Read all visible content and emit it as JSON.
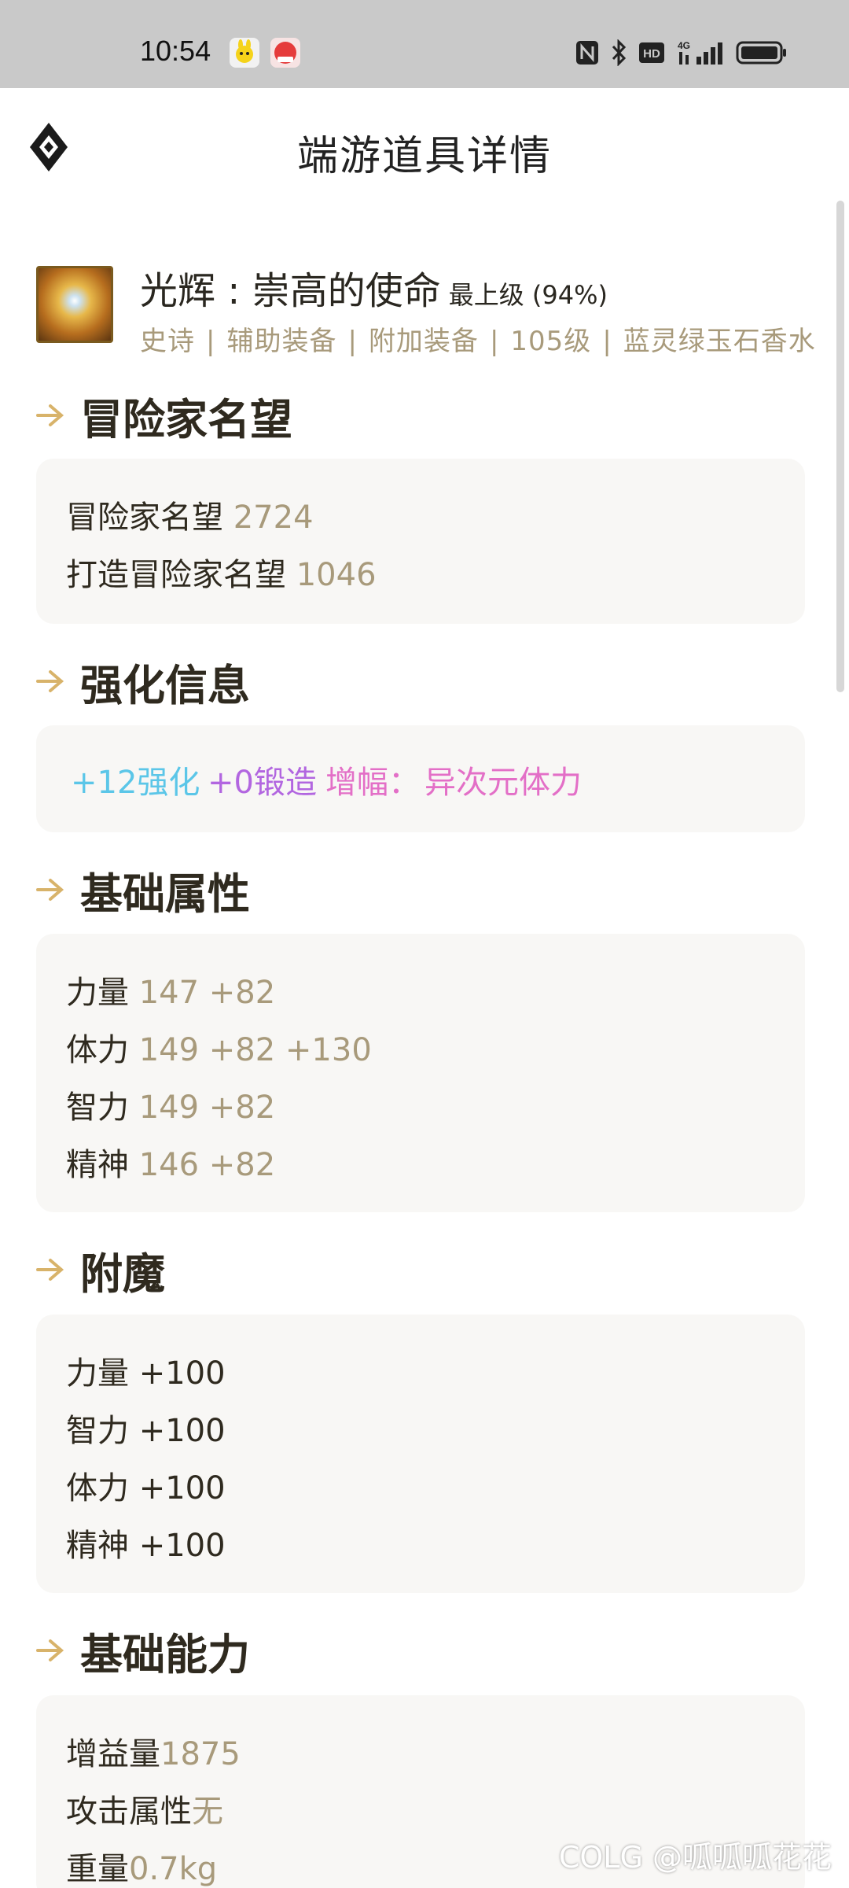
{
  "status_bar": {
    "time": "10:54",
    "icons": [
      "app-icon-yellow",
      "app-icon-red",
      "nfc-icon",
      "bluetooth-icon",
      "hd-icon",
      "4g-signal-icon",
      "battery-icon"
    ],
    "hd_label": "HD",
    "net_label": "4G"
  },
  "header": {
    "title": "端游道具详情",
    "logo_icon": "diamond-logo-icon"
  },
  "item": {
    "name": "光辉 : 崇高的使命",
    "grade": "最上级 (94%)",
    "tags": [
      "史诗",
      "辅助装备",
      "附加装备",
      "105级",
      "蓝灵绿玉石香水"
    ],
    "separator": "|"
  },
  "sections": {
    "reputation": {
      "title": "冒险家名望",
      "rows": [
        {
          "label": "冒险家名望",
          "value": "2724"
        },
        {
          "label": "打造冒险家名望",
          "value": "1046"
        }
      ]
    },
    "enhance": {
      "title": "强化信息",
      "reinforce": "+12强化",
      "forge": "+0锻造",
      "amplify_label": "增幅：",
      "amplify_value": "异次元体力",
      "colors": {
        "reinforce": "#5bc6e8",
        "forge": "#b266e0",
        "amplify": "#e36fc7"
      }
    },
    "base_attr": {
      "title": "基础属性",
      "rows": [
        {
          "label": "力量",
          "value": "147 +82"
        },
        {
          "label": "体力",
          "value": "149 +82 +130"
        },
        {
          "label": "智力",
          "value": "149 +82"
        },
        {
          "label": "精神",
          "value": "146 +82"
        }
      ]
    },
    "enchant": {
      "title": "附魔",
      "rows": [
        {
          "label": "力量",
          "value": "+100"
        },
        {
          "label": "智力",
          "value": "+100"
        },
        {
          "label": "体力",
          "value": "+100"
        },
        {
          "label": "精神",
          "value": "+100"
        }
      ]
    },
    "base_ability": {
      "title": "基础能力",
      "rows": [
        {
          "label": "增益量",
          "value": "1875"
        },
        {
          "label": "攻击属性",
          "value": "无"
        },
        {
          "label": "重量",
          "value": "0.7kg"
        }
      ]
    }
  },
  "watermark": "COLG @呱呱呱花花",
  "colors": {
    "accent_gold": "#d8b36a",
    "muted_value": "#a89a7b",
    "card_bg": "#f8f7f5",
    "status_bar_bg": "#c9c9c9"
  }
}
